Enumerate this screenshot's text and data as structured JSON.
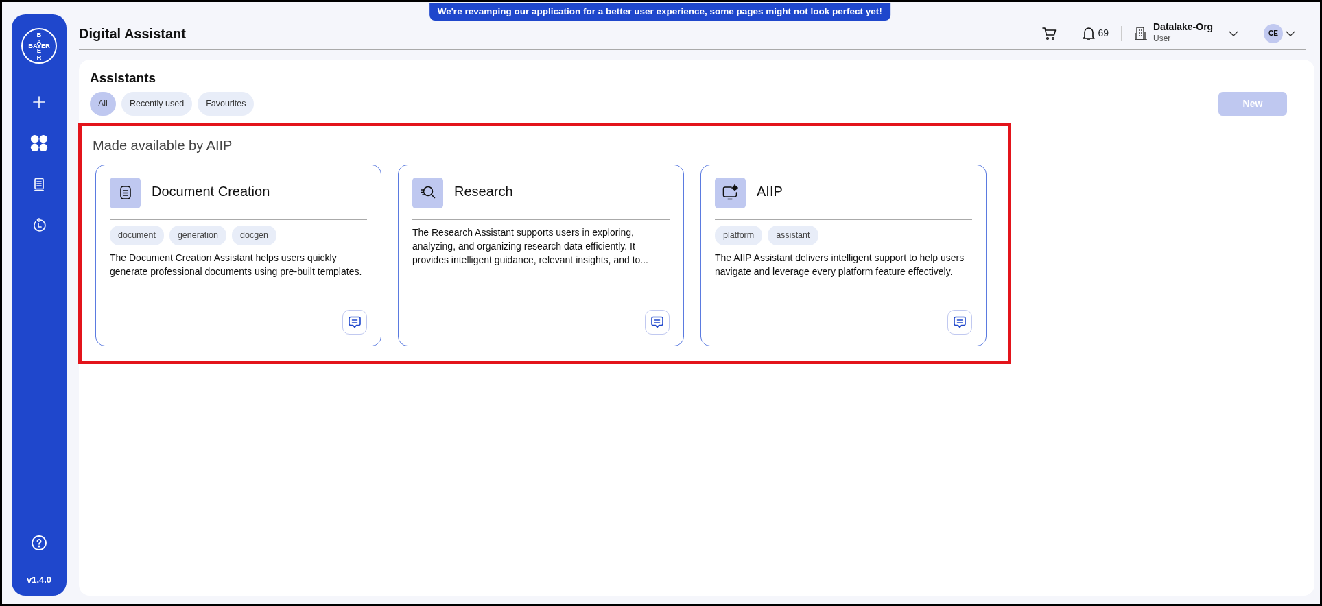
{
  "banner": "We're revamping our application for a better user experience, some pages might not look perfect yet!",
  "sidebar": {
    "logo": {
      "horizontal": "BAYER",
      "vertical_top": "BA",
      "vertical_bottom": "ER"
    },
    "items": [
      {
        "kind": "plus",
        "selected": false
      },
      {
        "kind": "grid",
        "selected": true
      },
      {
        "kind": "book",
        "selected": false
      },
      {
        "kind": "history",
        "selected": false
      }
    ],
    "version": "v1.4.0"
  },
  "header": {
    "title": "Digital Assistant",
    "notifications": "69",
    "org": "Datalake-Org",
    "role": "User",
    "avatar": "CE"
  },
  "panel": {
    "title": "Assistants",
    "filters": [
      {
        "label": "All",
        "selected": true
      },
      {
        "label": "Recently used",
        "selected": false
      },
      {
        "label": "Favourites",
        "selected": false
      }
    ],
    "new_button": {
      "label": "New",
      "disabled": true
    },
    "section_title": "Made available by AIIP",
    "assistants": [
      {
        "kind": "document",
        "title": "Document Creation",
        "tags": [
          "document",
          "generation",
          "docgen"
        ],
        "description": "The Document Creation Assistant helps users quickly generate professional documents using pre-built templates."
      },
      {
        "kind": "research",
        "title": "Research",
        "description": "The Research Assistant supports users in exploring, analyzing, and organizing research data efficiently. It provides intelligent guidance, relevant insights, and to..."
      },
      {
        "kind": "platform",
        "title": "AIIP",
        "tags": [
          "platform",
          "assistant"
        ],
        "description": "The AIIP Assistant delivers intelligent support to help users navigate and leverage every platform feature effectively."
      }
    ]
  }
}
